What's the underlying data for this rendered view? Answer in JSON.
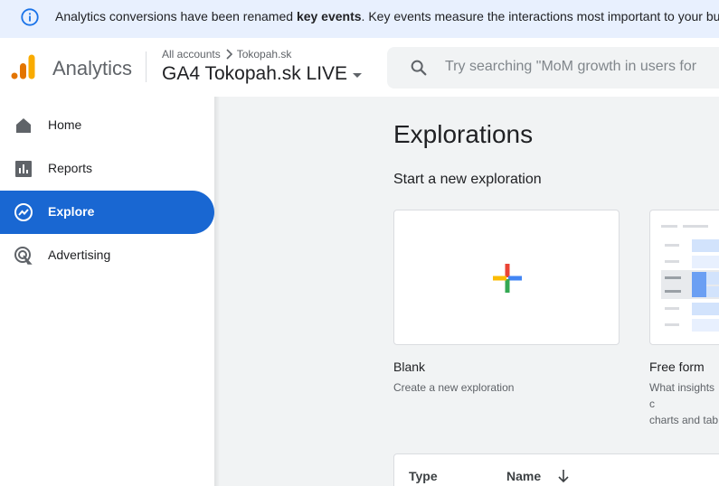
{
  "banner": {
    "text_before": "Analytics conversions have been renamed ",
    "bold_text": "key events",
    "text_after": ". Key events measure the interactions most important to your business."
  },
  "header": {
    "app_name": "Analytics",
    "breadcrumb_account": "All accounts",
    "breadcrumb_property": "Tokopah.sk",
    "property_name": "GA4 Tokopah.sk LIVE",
    "search_placeholder": "Try searching \"MoM growth in users for"
  },
  "sidebar": {
    "items": [
      {
        "label": "Home",
        "icon": "home-icon"
      },
      {
        "label": "Reports",
        "icon": "reports-icon"
      },
      {
        "label": "Explore",
        "icon": "explore-icon",
        "active": true
      },
      {
        "label": "Advertising",
        "icon": "advertising-icon"
      }
    ]
  },
  "main": {
    "title": "Explorations",
    "section_title": "Start a new exploration",
    "templates": [
      {
        "title": "Blank",
        "description": "Create a new exploration"
      },
      {
        "title": "Free form",
        "description_line1": "What insights c",
        "description_line2": "charts and tab"
      }
    ],
    "table": {
      "columns": [
        "Type",
        "Name"
      ]
    }
  },
  "colors": {
    "accent": "#1967d2",
    "banner_bg": "#e8f0fe",
    "main_bg": "#f1f3f4"
  }
}
